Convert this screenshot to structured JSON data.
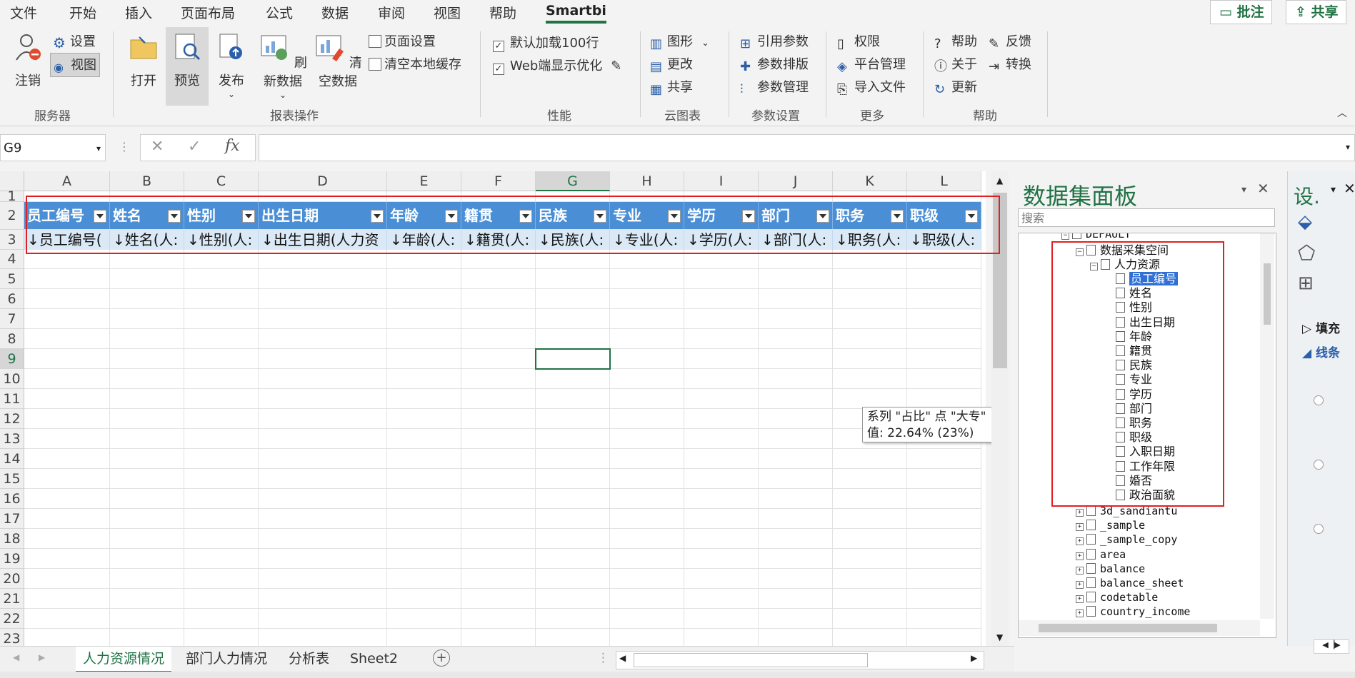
{
  "menu": [
    "文件",
    "开始",
    "插入",
    "页面布局",
    "公式",
    "数据",
    "审阅",
    "视图",
    "帮助",
    "Smartbi"
  ],
  "topbuttons": {
    "comment": "批注",
    "share": "共享"
  },
  "ribbon": {
    "server": {
      "logout": "注销",
      "settings": "设置",
      "view": "视图",
      "label": "服务器"
    },
    "report": {
      "open": "打开",
      "preview": "预览",
      "publish": "发布",
      "refresh": "刷新数据",
      "clear": "清空数据",
      "page_setup": "页面设置",
      "clear_cache": "清空本地缓存",
      "label": "报表操作"
    },
    "perf": {
      "load100": "默认加载100行",
      "web_opt": "Web端显示优化",
      "label": "性能"
    },
    "cloud": {
      "graph": "图形",
      "change": "更改",
      "share": "共享",
      "label": "云图表"
    },
    "param": {
      "ref": "引用参数",
      "sort": "参数排版",
      "manage": "参数管理",
      "label": "参数设置"
    },
    "more": {
      "perm": "权限",
      "platform": "平台管理",
      "import": "导入文件",
      "label": "更多"
    },
    "help": {
      "help": "帮助",
      "feedback": "反馈",
      "about": "关于",
      "convert": "转换",
      "update": "更新",
      "label": "帮助"
    }
  },
  "namebox": "G9",
  "columns": [
    "A",
    "B",
    "C",
    "D",
    "E",
    "F",
    "G",
    "H",
    "I",
    "J",
    "K",
    "L"
  ],
  "rows": [
    "1",
    "2",
    "3",
    "4",
    "5",
    "6",
    "7",
    "8",
    "9",
    "10",
    "11",
    "12",
    "13",
    "14",
    "15",
    "16",
    "17",
    "18",
    "19",
    "20",
    "21",
    "22",
    "23"
  ],
  "header_cells": [
    "员工编号",
    "姓名",
    "性别",
    "出生日期",
    "年龄",
    "籍贯",
    "民族",
    "专业",
    "学历",
    "部门",
    "职务",
    "职级"
  ],
  "data_cells": [
    "↓员工编号(",
    "↓姓名(人:",
    "↓性别(人:",
    "↓出生日期(人力资",
    "↓年龄(人:",
    "↓籍贯(人:",
    "↓民族(人:",
    "↓专业(人:",
    "↓学历(人:",
    "↓部门(人:",
    "↓职务(人:",
    "↓职级(人:"
  ],
  "tooltip": {
    "line1": "系列 \"占比\" 点 \"大专\"",
    "line2": "值: 22.64% (23%)"
  },
  "tabs": [
    "人力资源情况",
    "部门人力情况",
    "分析表",
    "Sheet2"
  ],
  "panel": {
    "title": "数据集面板",
    "search_placeholder": "搜索",
    "tree": {
      "root": "DEFAULT",
      "space": "数据采集空间",
      "table": "人力资源",
      "fields": [
        "员工编号",
        "姓名",
        "性别",
        "出生日期",
        "年龄",
        "籍贯",
        "民族",
        "专业",
        "学历",
        "部门",
        "职务",
        "职级",
        "入职日期",
        "工作年限",
        "婚否",
        "政治面貌"
      ],
      "others": [
        "3d_sandiantu",
        "_sample",
        "_sample_copy",
        "area",
        "balance",
        "balance_sheet",
        "codetable",
        "country_income"
      ]
    }
  },
  "side": {
    "title": "设.",
    "fill": "填充",
    "line": "线条"
  }
}
